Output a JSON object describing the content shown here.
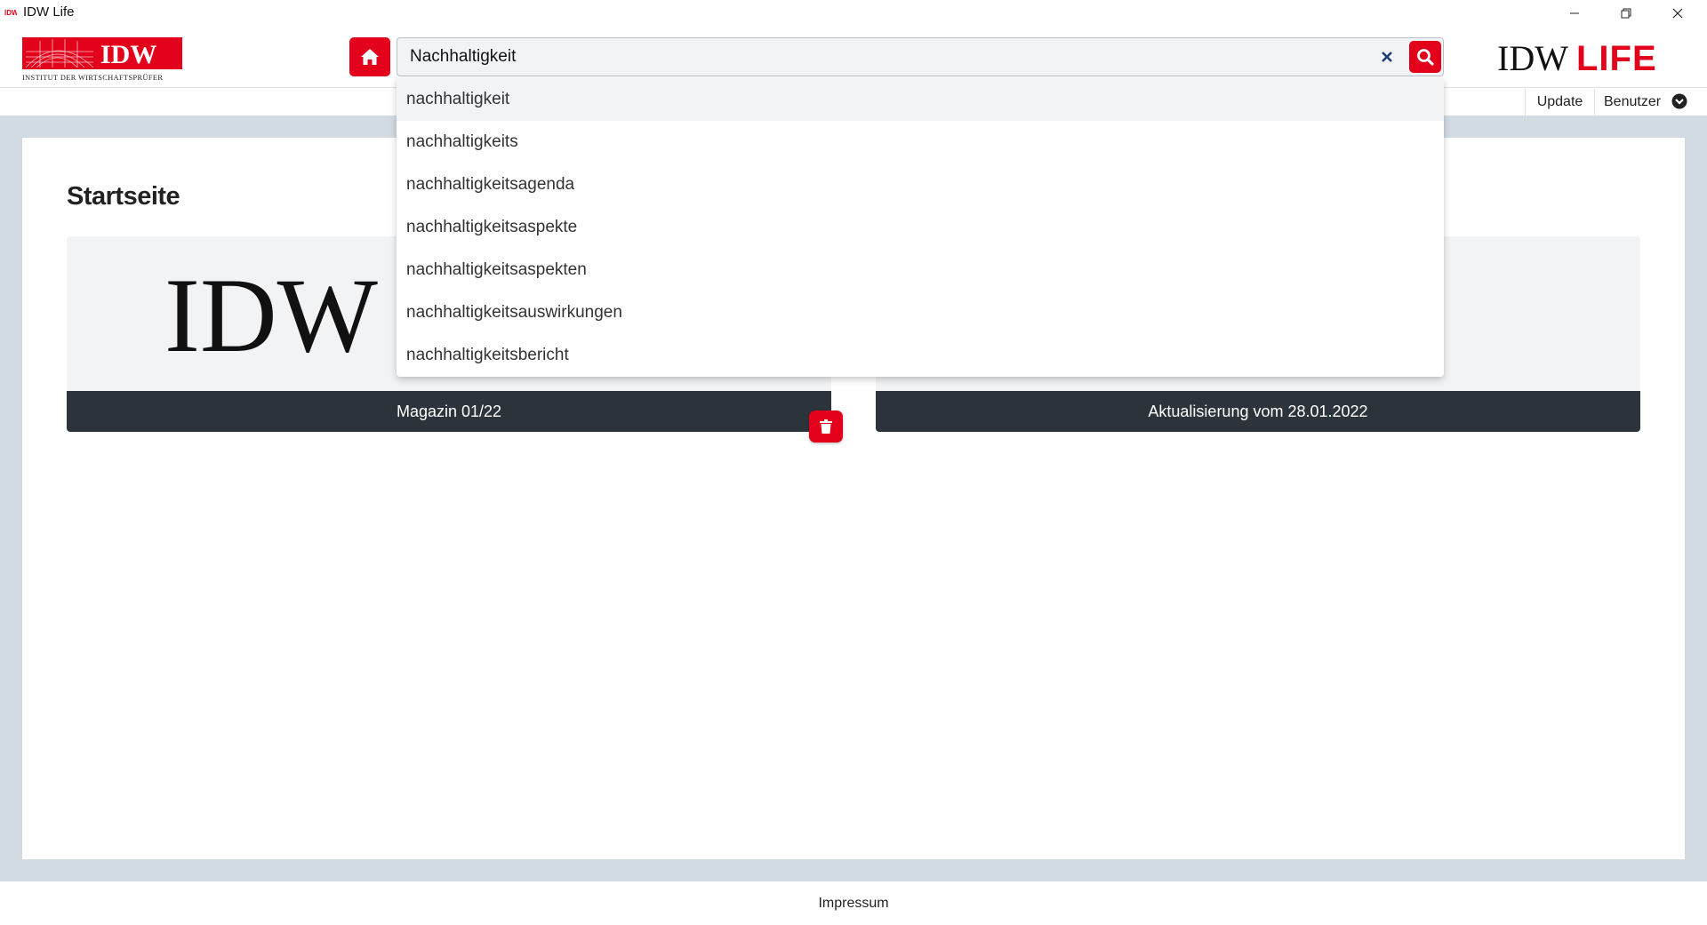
{
  "window": {
    "title": "IDW Life",
    "controls": [
      "minimize",
      "maximize",
      "close"
    ]
  },
  "header": {
    "logo_main": "IDW",
    "logo_sub": "INSTITUT DER WIRTSCHAFTSPRÜFER",
    "logo_life_left": "IDW",
    "logo_life_right": "LIFE",
    "search": {
      "value": "Nachhaltigkeit"
    },
    "icons": {
      "home": "home-icon",
      "clear": "close-icon",
      "search": "search-icon"
    }
  },
  "subnav": {
    "update_label": "Update",
    "user_label": "Benutzer"
  },
  "autocomplete": {
    "items": [
      "nachhaltigkeit",
      "nachhaltigkeits",
      "nachhaltigkeitsagenda",
      "nachhaltigkeitsaspekte",
      "nachhaltigkeitsaspekten",
      "nachhaltigkeitsauswirkungen",
      "nachhaltigkeitsbericht"
    ]
  },
  "main": {
    "page_title": "Startseite",
    "cards": [
      {
        "thumb": "IDW",
        "caption": "Magazin 01/22"
      },
      {
        "thumb": "/",
        "caption": "Aktualisierung vom 28.01.2022"
      }
    ]
  },
  "footer": {
    "link": "Impressum"
  },
  "colors": {
    "brand_red": "#e2001a",
    "dark_bar": "#2c333b",
    "page_bg": "#d2dae2"
  }
}
